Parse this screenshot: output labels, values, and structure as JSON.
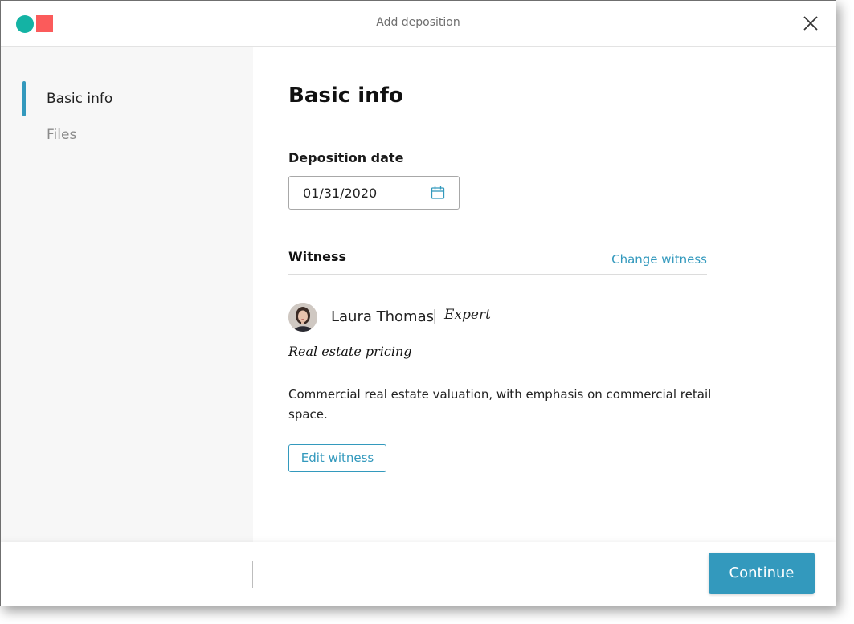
{
  "colors": {
    "accent": "#3399bd",
    "logo_circle": "#14b3a4",
    "logo_square": "#fb5b5b"
  },
  "header": {
    "title": "Add deposition",
    "logo_icon": "app-logo",
    "close_icon": "close-icon"
  },
  "sidebar": {
    "items": [
      {
        "label": "Basic info",
        "active": true
      },
      {
        "label": "Files",
        "active": false
      }
    ]
  },
  "main": {
    "title": "Basic info",
    "deposition_date": {
      "label": "Deposition date",
      "value": "01/31/2020",
      "icon": "calendar-icon"
    },
    "witness": {
      "section_title": "Witness",
      "change_link": "Change witness",
      "name": "Laura Thomas",
      "type": "Expert",
      "specialty": "Real estate pricing",
      "description": "Commercial real estate valuation, with emphasis on commercial retail space.",
      "edit_button": "Edit witness"
    }
  },
  "footer": {
    "continue_button": "Continue"
  }
}
